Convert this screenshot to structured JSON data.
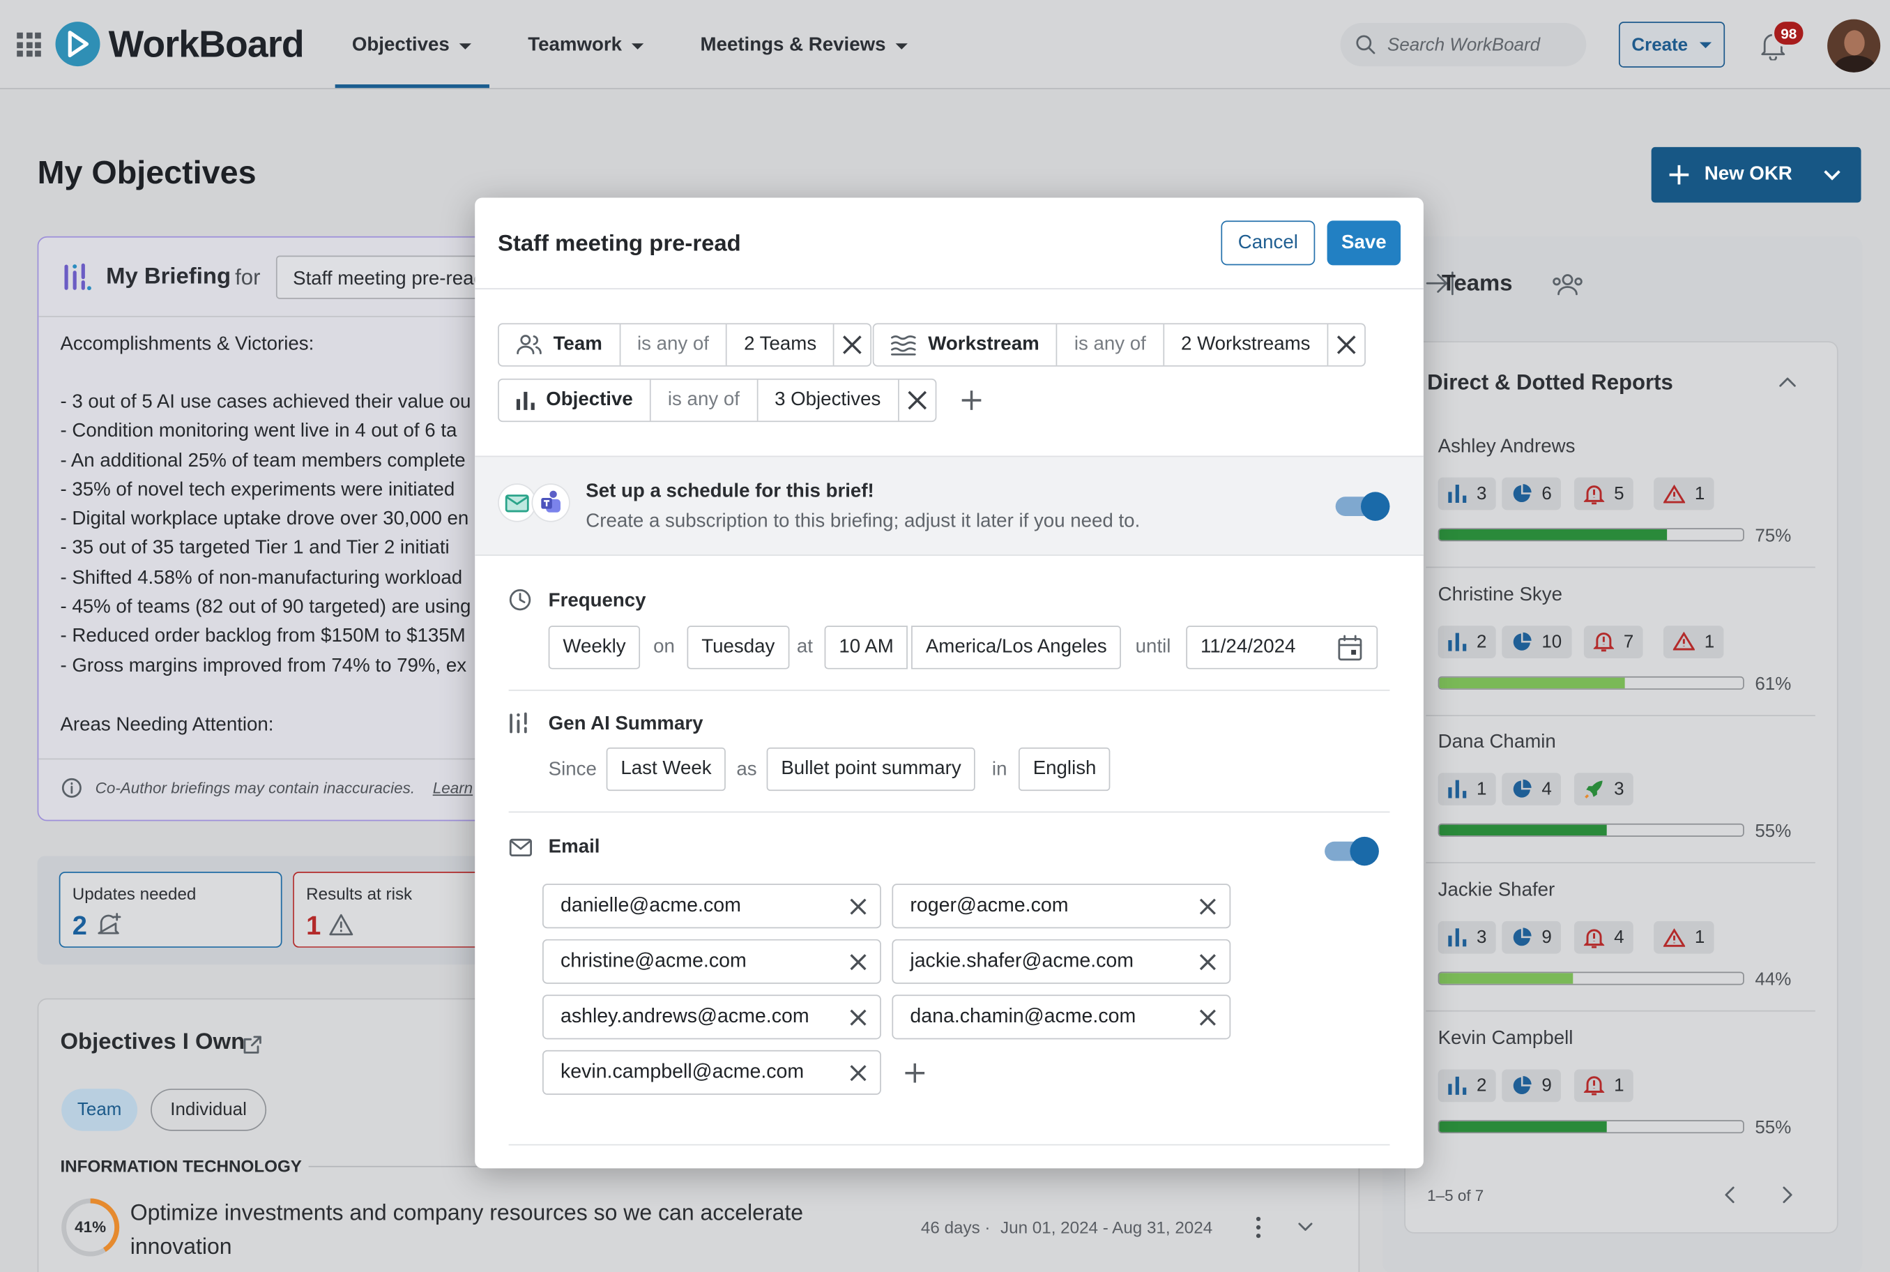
{
  "app": {
    "name": "WorkBoard"
  },
  "nav": {
    "items": [
      "Objectives",
      "Teamwork",
      "Meetings & Reviews"
    ],
    "search_placeholder": "Search WorkBoard",
    "create_label": "Create",
    "notification_count": "98"
  },
  "page": {
    "title": "My Objectives",
    "new_okr_label": "New OKR"
  },
  "briefing": {
    "label": "My Briefing",
    "for": "for",
    "select_value": "Staff meeting pre-read",
    "section1": "Accomplishments & Victories:",
    "bullets": [
      "- 3 out of 5 AI use cases achieved their value ou",
      "- Condition monitoring went live in 4 out of 6 ta",
      "- An additional 25% of team members complete",
      "- 35% of novel tech experiments were initiated",
      "- Digital workplace uptake drove over 30,000 en",
      "- 35 out of 35 targeted Tier 1 and Tier 2 initiati",
      "- Shifted 4.58% of non-manufacturing workload",
      "- 45% of teams (82 out of 90 targeted) are using",
      "- Reduced order backlog from $150M to $135M",
      "- Gross margins improved from 74% to 79%, ex"
    ],
    "section2": "Areas Needing Attention:",
    "disclaimer": "Co-Author briefings may contain inaccuracies.",
    "learn": "Learn"
  },
  "stats_cards": {
    "updates": {
      "label": "Updates needed",
      "value": "2"
    },
    "risk": {
      "label": "Results at risk",
      "value": "1"
    }
  },
  "own": {
    "title": "Objectives I Own",
    "tabs": [
      "Team",
      "Individual"
    ],
    "group": "INFORMATION TECHNOLOGY",
    "objective": {
      "progress": "41%",
      "progress_value": 0.41,
      "title_line1": "Optimize investments and company resources so we can accelerate",
      "title_line2": "innovation",
      "days": "46 days ·",
      "dates": "Jun 01, 2024 - Aug 31, 2024"
    }
  },
  "modal": {
    "title": "Staff meeting pre-read",
    "cancel": "Cancel",
    "save": "Save",
    "filters": [
      {
        "field": "Team",
        "op": "is any of",
        "value": "2 Teams"
      },
      {
        "field": "Workstream",
        "op": "is any of",
        "value": "2 Workstreams"
      },
      {
        "field": "Objective",
        "op": "is any of",
        "value": "3 Objectives"
      }
    ],
    "schedule": {
      "title": "Set up a schedule for this brief!",
      "subtitle": "Create a subscription to this briefing; adjust it later if you need to.",
      "enabled": true
    },
    "frequency": {
      "label": "Frequency",
      "value": "Weekly",
      "on": "on",
      "day": "Tuesday",
      "at": "at",
      "time": "10 AM",
      "timezone": "America/Los Angeles",
      "until": "until",
      "end_date": "11/24/2024"
    },
    "genai": {
      "label": "Gen AI Summary",
      "since": "Since",
      "since_value": "Last Week",
      "as": "as",
      "format": "Bullet point summary",
      "in": "in",
      "language": "English"
    },
    "email": {
      "label": "Email",
      "enabled": true,
      "addresses": [
        "danielle@acme.com",
        "roger@acme.com",
        "christine@acme.com",
        "jackie.shafer@acme.com",
        "ashley.andrews@acme.com",
        "dana.chamin@acme.com",
        "kevin.campbell@acme.com"
      ]
    }
  },
  "teams": {
    "title": "Teams",
    "section": "Direct & Dotted Reports",
    "people": [
      {
        "name": "Ashley Andrews",
        "stats": [
          {
            "icon": "bar-chart-icon",
            "value": "3"
          },
          {
            "icon": "pie-chart-icon",
            "value": "6"
          },
          {
            "icon": "alert-bell-icon",
            "value": "5"
          },
          {
            "icon": "warning-icon",
            "value": "1"
          }
        ],
        "progress": 0.75,
        "pct": "75%",
        "color": "#2a8a3a"
      },
      {
        "name": "Christine Skye",
        "stats": [
          {
            "icon": "bar-chart-icon",
            "value": "2"
          },
          {
            "icon": "pie-chart-icon",
            "value": "10"
          },
          {
            "icon": "alert-bell-icon",
            "value": "7"
          },
          {
            "icon": "warning-icon",
            "value": "1"
          }
        ],
        "progress": 0.61,
        "pct": "61%",
        "color": "#7ab957"
      },
      {
        "name": "Dana Chamin",
        "stats": [
          {
            "icon": "bar-chart-icon",
            "value": "1"
          },
          {
            "icon": "pie-chart-icon",
            "value": "4"
          },
          {
            "icon": "rocket-icon",
            "value": "3"
          }
        ],
        "progress": 0.55,
        "pct": "55%",
        "color": "#2a8a3a"
      },
      {
        "name": "Jackie Shafer",
        "stats": [
          {
            "icon": "bar-chart-icon",
            "value": "3"
          },
          {
            "icon": "pie-chart-icon",
            "value": "9"
          },
          {
            "icon": "alert-bell-icon",
            "value": "4"
          },
          {
            "icon": "warning-icon",
            "value": "1"
          }
        ],
        "progress": 0.44,
        "pct": "44%",
        "color": "#7ab957"
      },
      {
        "name": "Kevin Campbell",
        "stats": [
          {
            "icon": "bar-chart-icon",
            "value": "2"
          },
          {
            "icon": "pie-chart-icon",
            "value": "9"
          },
          {
            "icon": "alert-bell-icon",
            "value": "1"
          }
        ],
        "progress": 0.55,
        "pct": "55%",
        "color": "#2a8a3a"
      }
    ],
    "pagination": "1–5 of 7"
  }
}
